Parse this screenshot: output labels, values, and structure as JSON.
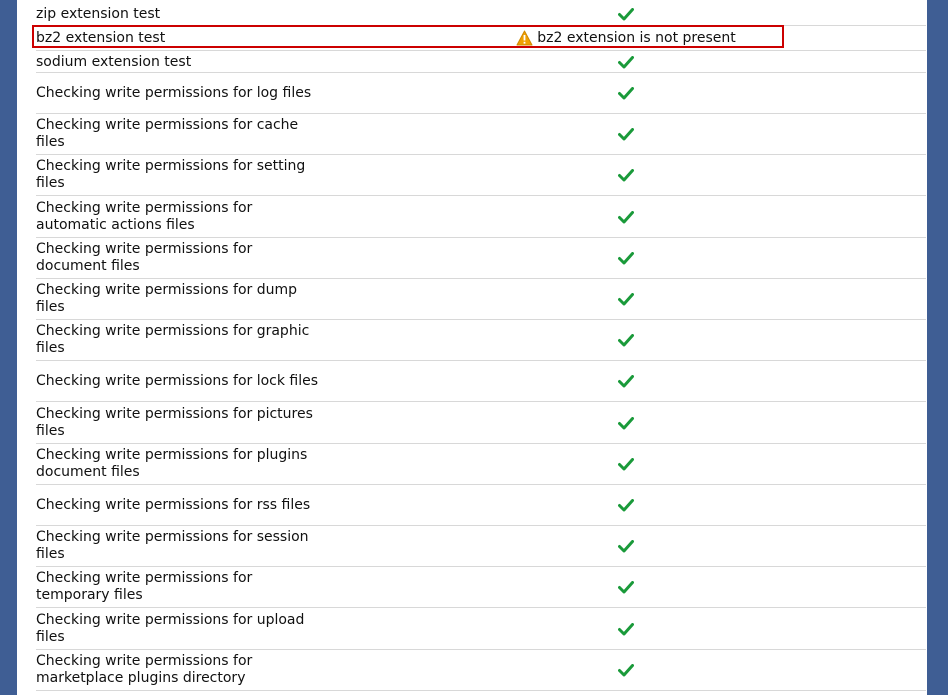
{
  "rows": [
    {
      "label": "zip extension test",
      "status": "ok"
    },
    {
      "label": "bz2 extension test",
      "status": "warning",
      "message": "bz2 extension is not present"
    },
    {
      "label": "sodium extension test",
      "status": "ok"
    },
    {
      "label": "Checking write permissions for log files",
      "status": "ok"
    },
    {
      "label": "Checking write permissions for cache files",
      "status": "ok"
    },
    {
      "label": "Checking write permissions for setting files",
      "status": "ok"
    },
    {
      "label": "Checking write permissions for automatic actions files",
      "status": "ok"
    },
    {
      "label": "Checking write permissions for document files",
      "status": "ok"
    },
    {
      "label": "Checking write permissions for dump files",
      "status": "ok"
    },
    {
      "label": "Checking write permissions for graphic files",
      "status": "ok"
    },
    {
      "label": "Checking write permissions for lock files",
      "status": "ok"
    },
    {
      "label": "Checking write permissions for pictures files",
      "status": "ok"
    },
    {
      "label": "Checking write permissions for plugins document files",
      "status": "ok"
    },
    {
      "label": "Checking write permissions for rss files",
      "status": "ok"
    },
    {
      "label": "Checking write permissions for session files",
      "status": "ok"
    },
    {
      "label": "Checking write permissions for temporary files",
      "status": "ok"
    },
    {
      "label": "Checking write permissions for upload files",
      "status": "ok"
    },
    {
      "label": "Checking write permissions for marketplace plugins directory",
      "status": "ok"
    }
  ],
  "colors": {
    "ok": "#1a9a3a",
    "warning": "#f0a000",
    "highlight_border": "#cc0000",
    "background": "#3f5e94"
  },
  "icons": {
    "ok": "check-icon",
    "warning": "warning-icon"
  }
}
